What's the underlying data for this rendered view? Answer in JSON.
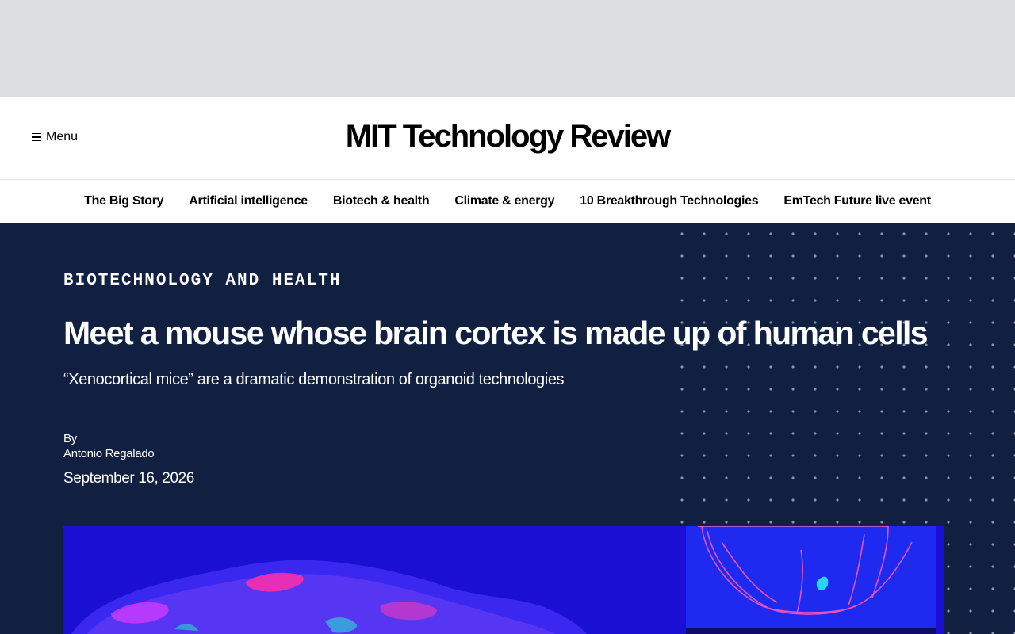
{
  "header": {
    "menu_label": "Menu",
    "logo_text": "MIT Technology Review"
  },
  "nav": {
    "items": [
      {
        "label": "The Big Story"
      },
      {
        "label": "Artificial intelligence"
      },
      {
        "label": "Biotech & health"
      },
      {
        "label": "Climate & energy"
      },
      {
        "label": "10 Breakthrough Technologies"
      },
      {
        "label": "EmTech Future live event"
      }
    ]
  },
  "article": {
    "kicker": "BIOTECHNOLOGY AND HEALTH",
    "headline": "Meet a mouse whose brain cortex is made up of human cells",
    "dek": "“Xenocortical mice” are a dramatic demonstration of organoid technologies",
    "byline_prefix": "By",
    "author": "Antonio Regalado",
    "date": "September 16, 2026"
  },
  "colors": {
    "hero_background": "#112041",
    "ad_background": "#dcdde0"
  },
  "icons": {
    "menu": "hamburger-icon"
  }
}
